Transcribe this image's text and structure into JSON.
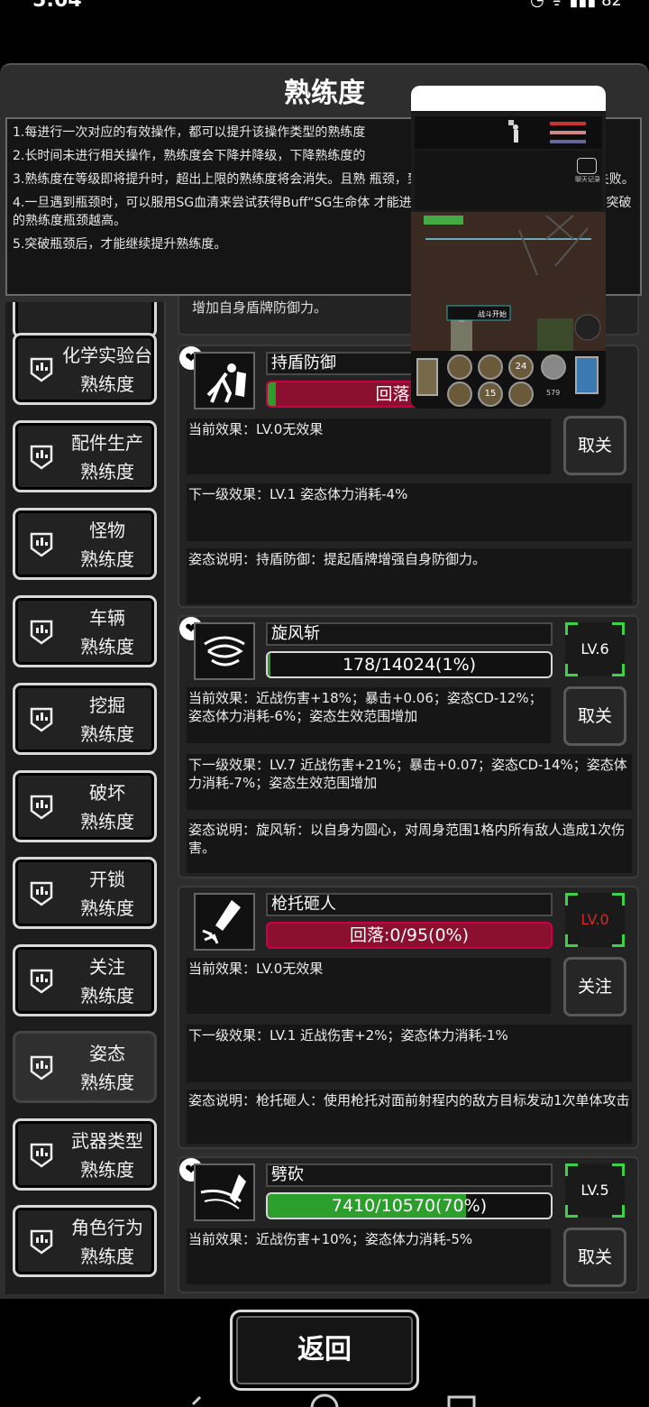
{
  "status_bar": {
    "time": "5:04",
    "right": "◔ ᯤ ▮▮▮ 82"
  },
  "page_title": "熟练度",
  "rules": [
    "1.每进行一次对应的有效操作，都可以提升该操作类型的熟练度",
    "2.长时间未进行相关操作，熟练度会下降并降级，下降熟练度的",
    "3.熟练度在等级即将提升时，超出上限的熟练度将会消失。且熟 瓶颈，到达瓶颈等级时会提示熟练度突破失败。",
    "4.一旦遇到瓶颈时，可以服用SG血清来尝试获得Buff“SG生命体 才能进行突破。SG生命体Buff等级越高可突破的熟练度瓶颈越高。",
    "5.突破瓶颈后，才能继续提升熟练度。"
  ],
  "sidebar": [
    {
      "line1": "化学实验台",
      "line2": "熟练度",
      "icon": "badge-icon"
    },
    {
      "line1": "配件生产",
      "line2": "熟练度",
      "icon": "badge-icon"
    },
    {
      "line1": "怪物",
      "line2": "熟练度",
      "icon": "badge-icon"
    },
    {
      "line1": "车辆",
      "line2": "熟练度",
      "icon": "badge-icon"
    },
    {
      "line1": "挖掘",
      "line2": "熟练度",
      "icon": "badge-icon"
    },
    {
      "line1": "破坏",
      "line2": "熟练度",
      "icon": "badge-icon"
    },
    {
      "line1": "开锁",
      "line2": "熟练度",
      "icon": "badge-icon"
    },
    {
      "line1": "关注",
      "line2": "熟练度",
      "icon": "badge-icon"
    },
    {
      "line1": "姿态",
      "line2": "熟练度",
      "icon": "badge-icon",
      "active": true
    },
    {
      "line1": "武器类型",
      "line2": "熟练度",
      "icon": "badge-icon"
    },
    {
      "line1": "角色行为",
      "line2": "熟练度",
      "icon": "badge-icon"
    }
  ],
  "partial_top_text": "增加自身盾牌防御力。",
  "skills": [
    {
      "name": "持盾防御",
      "progress_text": "回落:6/1",
      "progress": 0.03,
      "bar_style": "red",
      "level": "",
      "current": "当前效果：LV.0无效果",
      "action": "取关",
      "next": "下一级效果：LV.1 姿态体力消耗-4%",
      "desc": "姿态说明：持盾防御：提起盾牌增强自身防御力。"
    },
    {
      "name": "旋风斩",
      "progress_text": "178/14024(1%)",
      "progress": 0.01,
      "bar_style": "green",
      "level": "LV.6",
      "current": "当前效果：近战伤害+18%；暴击+0.06；姿态CD-12%；姿态体力消耗-6%；姿态生效范围增加",
      "action": "取关",
      "next": "下一级效果：LV.7 近战伤害+21%；暴击+0.07；姿态CD-14%；姿态体力消耗-7%；姿态生效范围增加",
      "desc": "姿态说明：旋风斩：以自身为圆心，对周身范围1格内所有敌人造成1次伤害。"
    },
    {
      "name": "枪托砸人",
      "progress_text": "回落:0/95(0%)",
      "progress": 0,
      "bar_style": "red",
      "level": "LV.0",
      "current": "当前效果：LV.0无效果",
      "action": "关注",
      "next": "下一级效果：LV.1 近战伤害+2%；姿态体力消耗-1%",
      "desc": "姿态说明：枪托砸人：使用枪托对面前射程内的敌方目标发动1次单体攻击"
    },
    {
      "name": "劈砍",
      "progress_text": "7410/10570(70%)",
      "progress": 0.7,
      "bar_style": "green",
      "level": "LV.5",
      "current": "当前效果：近战伤害+10%；姿态体力消耗-5%",
      "action": "取关"
    }
  ],
  "overlay": {
    "bubble": "聊天记录",
    "caption": "战斗开始",
    "slot_labels": [
      "24",
      "15"
    ],
    "ammo": "579"
  },
  "back_button": "返回"
}
